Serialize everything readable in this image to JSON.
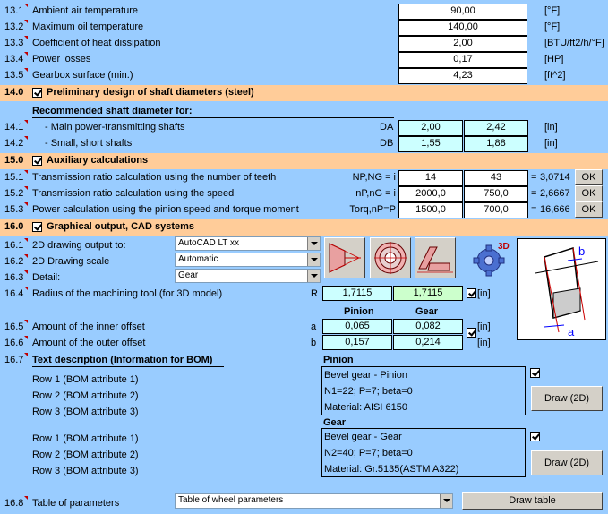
{
  "rows_a": [
    {
      "num": "13.1",
      "label": "Ambient air temperature",
      "value": "90,00",
      "unit": "[°F]"
    },
    {
      "num": "13.2",
      "label": "Maximum oil temperature",
      "value": "140,00",
      "unit": "[°F]"
    },
    {
      "num": "13.3",
      "label": "Coefficient of heat dissipation",
      "value": "2,00",
      "unit": "[BTU/ft2/h/°F]"
    },
    {
      "num": "13.4",
      "label": "Power losses",
      "value": "0,17",
      "unit": "[HP]"
    },
    {
      "num": "13.5",
      "label": "Gearbox surface (min.)",
      "value": "4,23",
      "unit": "[ft^2]"
    }
  ],
  "sec14": {
    "num": "14.0",
    "title": "Preliminary design of shaft diameters (steel)"
  },
  "sec14_sub": "Recommended shaft diameter for:",
  "rows_14": [
    {
      "num": "14.1",
      "label": "- Main power-transmitting shafts",
      "sym": "DA",
      "v1": "2,00",
      "v2": "2,42",
      "unit": "[in]"
    },
    {
      "num": "14.2",
      "label": "- Small, short shafts",
      "sym": "DB",
      "v1": "1,55",
      "v2": "1,88",
      "unit": "[in]"
    }
  ],
  "sec15": {
    "num": "15.0",
    "title": "Auxiliary calculations"
  },
  "rows_15": [
    {
      "num": "15.1",
      "label": "Transmission ratio calculation using the number of teeth",
      "sym": "NP,NG = i",
      "v1": "14",
      "v2": "43",
      "eq": "=",
      "res": "3,0714",
      "ok": "OK"
    },
    {
      "num": "15.2",
      "label": "Transmission ratio calculation using the speed",
      "sym": "nP,nG = i",
      "v1": "2000,0",
      "v2": "750,0",
      "eq": "=",
      "res": "2,6667",
      "ok": "OK"
    },
    {
      "num": "15.3",
      "label": "Power calculation using the pinion speed and torque moment",
      "sym": "Torq,nP=P",
      "v1": "1500,0",
      "v2": "700,0",
      "eq": "=",
      "res": "16,666",
      "ok": "OK"
    }
  ],
  "sec16": {
    "num": "16.0",
    "title": "Graphical output, CAD systems"
  },
  "r161": {
    "num": "16.1",
    "label": "2D drawing output to:",
    "value": "AutoCAD LT xx"
  },
  "r162": {
    "num": "16.2",
    "label": "2D Drawing scale",
    "value": "Automatic"
  },
  "r163": {
    "num": "16.3",
    "label": "Detail:",
    "value": "Gear"
  },
  "r164": {
    "num": "16.4",
    "label": "Radius of the machining tool (for 3D model)",
    "sym": "R",
    "v1": "1,7115",
    "v2": "1,7115",
    "unit": "[in]"
  },
  "col_pinion": "Pinion",
  "col_gear": "Gear",
  "r165": {
    "num": "16.5",
    "label": "Amount of the inner offset",
    "sym": "a",
    "v1": "0,065",
    "v2": "0,082",
    "unit": "[in]"
  },
  "r166": {
    "num": "16.6",
    "label": "Amount of the outer offset",
    "sym": "b",
    "v1": "0,157",
    "v2": "0,214",
    "unit": "[in]"
  },
  "r167": {
    "num": "16.7",
    "label": "Text description (Information for BOM)"
  },
  "bom_pinion": {
    "title": "Pinion",
    "rows": [
      "Row 1 (BOM attribute 1)",
      "Row 2 (BOM attribute 2)",
      "Row 3 (BOM attribute 3)"
    ],
    "values": [
      "Bevel gear - Pinion",
      "N1=22; P=7; beta=0",
      "Material: AISI 6150"
    ],
    "draw": "Draw (2D)"
  },
  "bom_gear": {
    "title": "Gear",
    "rows": [
      "Row 1 (BOM attribute 1)",
      "Row 2 (BOM attribute 2)",
      "Row 3 (BOM attribute 3)"
    ],
    "values": [
      "Bevel gear - Gear",
      "N2=40; P=7; beta=0",
      "Material: Gr.5135(ASTM A322)"
    ],
    "draw": "Draw (2D)"
  },
  "r168": {
    "num": "16.8",
    "label": "Table of parameters",
    "value": "Table of wheel parameters",
    "button": "Draw table"
  },
  "diagram": {
    "label_a": "a",
    "label_b": "b"
  },
  "badge_3d": "3D"
}
